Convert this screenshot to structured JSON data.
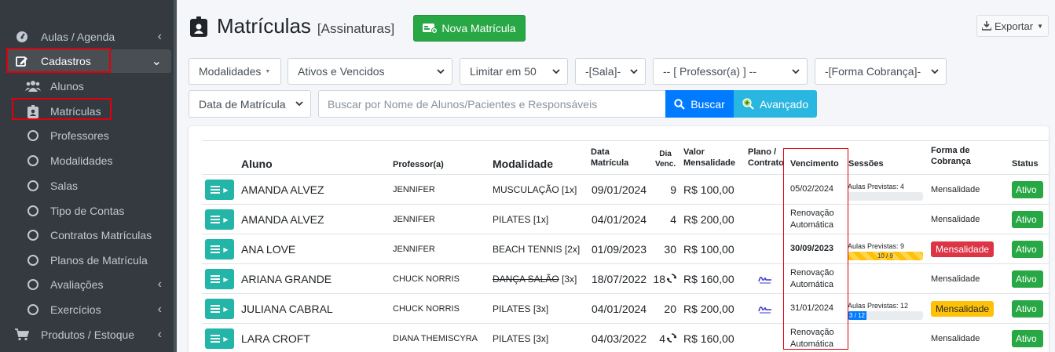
{
  "sidebar": {
    "items": [
      {
        "label": "Aulas / Agenda",
        "icon": "tachometer-icon"
      },
      {
        "label": "Cadastros",
        "icon": "edit-icon"
      },
      {
        "label": "Alunos",
        "icon": "users-icon"
      },
      {
        "label": "Matrículas",
        "icon": "id-badge-icon"
      },
      {
        "label": "Professores",
        "icon": "circle-icon"
      },
      {
        "label": "Modalidades",
        "icon": "circle-icon"
      },
      {
        "label": "Salas",
        "icon": "circle-icon"
      },
      {
        "label": "Tipo de Contas",
        "icon": "circle-icon"
      },
      {
        "label": "Contratos Matrículas",
        "icon": "circle-icon"
      },
      {
        "label": "Planos de Matrícula",
        "icon": "circle-icon"
      },
      {
        "label": "Avaliações",
        "icon": "circle-icon"
      },
      {
        "label": "Exercícios",
        "icon": "circle-icon"
      },
      {
        "label": "Produtos / Estoque",
        "icon": "cart-icon"
      }
    ]
  },
  "header": {
    "title": "Matrículas",
    "subtitle": "[Assinaturas]",
    "new_button": "Nova Matrícula",
    "export_button": "Exportar"
  },
  "filters": {
    "modalidades": "Modalidades",
    "status": "Ativos e Vencidos",
    "limit": "Limitar em 50",
    "sala": "-[Sala]-",
    "professor": "-- [ Professor(a) ] --",
    "cobranca": "-[Forma Cobrança]-",
    "date_field": "Data de Matrícula",
    "search_placeholder": "Buscar por Nome de Alunos/Pacientes e Responsáveis",
    "search_button": "Buscar",
    "advanced_button": "Avançado"
  },
  "table": {
    "headers": {
      "aluno": "Aluno",
      "professor": "Professor(a)",
      "modalidade": "Modalidade",
      "data_l1": "Data",
      "data_l2": "Matrícula",
      "dia_l1": "Dia",
      "dia_l2": "Venc.",
      "valor_l1": "Valor",
      "valor_l2": "Mensalidade",
      "plano_l1": "Plano /",
      "plano_l2": "Contrato",
      "vencimento": "Vencimento",
      "sessoes": "Sessões",
      "forma_l1": "Forma de",
      "forma_l2": "Cobrança",
      "status": "Status"
    },
    "rows": [
      {
        "aluno": "AMANDA ALVEZ",
        "professor": "JENNIFER",
        "modalidade": "MUSCULAÇÃO",
        "qtd": "[1x]",
        "data": "09/01/2024",
        "dia": "9",
        "valor": "R$ 100,00",
        "venc1": "05/02/2024",
        "venc2": "",
        "sessoes_label": "Aulas Previstas: 4",
        "sessoes_bar": "",
        "progress": 0,
        "forma": "Mensalidade",
        "status": "Ativo"
      },
      {
        "aluno": "AMANDA ALVEZ",
        "professor": "JENNIFER",
        "modalidade": "PILATES",
        "qtd": "[1x]",
        "data": "04/01/2024",
        "dia": "4",
        "valor": "R$ 200,00",
        "venc1": "Renovação",
        "venc2": "Automática",
        "sessoes_label": "",
        "sessoes_bar": "",
        "progress": 0,
        "forma": "Mensalidade",
        "status": "Ativo"
      },
      {
        "aluno": "ANA LOVE",
        "professor": "JENNIFER",
        "modalidade": "BEACH TENNIS",
        "qtd": "[2x]",
        "data": "01/09/2023",
        "dia": "30",
        "valor": "R$ 100,00",
        "venc1": "30/09/2023",
        "venc2": "",
        "sessoes_label": "Aulas Previstas: 9",
        "sessoes_bar": "10 / 9",
        "progress": 1.0,
        "forma": "Mensalidade",
        "status": "Ativo"
      },
      {
        "aluno": "ARIANA GRANDE",
        "professor": "CHUCK NORRIS",
        "modalidade": "DANÇA SALÃO",
        "qtd": "[3x]",
        "data": "18/07/2022",
        "dia": "18",
        "valor": "R$ 160,00",
        "venc1": "Renovação",
        "venc2": "Automática",
        "sessoes_label": "",
        "sessoes_bar": "",
        "progress": 0,
        "forma": "Mensalidade",
        "status": "Ativo"
      },
      {
        "aluno": "JULIANA CABRAL",
        "professor": "CHUCK NORRIS",
        "modalidade": "PILATES",
        "qtd": "[3x]",
        "data": "04/01/2024",
        "dia": "20",
        "valor": "R$ 200,00",
        "venc1": "31/01/2024",
        "venc2": "",
        "sessoes_label": "Aulas Previstas: 12",
        "sessoes_bar": "3 / 12",
        "progress": 0.25,
        "forma": "Mensalidade",
        "status": "Ativo"
      },
      {
        "aluno": "LARA CROFT",
        "professor": "DIANA THEMISCYRA",
        "modalidade": "PILATES",
        "qtd": "[3x]",
        "data": "04/03/2022",
        "dia": "4",
        "valor": "R$ 160,00",
        "venc1": "Renovação",
        "venc2": "Automática",
        "sessoes_label": "",
        "sessoes_bar": "",
        "progress": 0,
        "forma": "Mensalidade",
        "status": "Ativo"
      }
    ]
  },
  "colors": {
    "sidebar": "#343a40",
    "green": "#28a745",
    "blue": "#007bff",
    "highlight": "#e0000c"
  }
}
